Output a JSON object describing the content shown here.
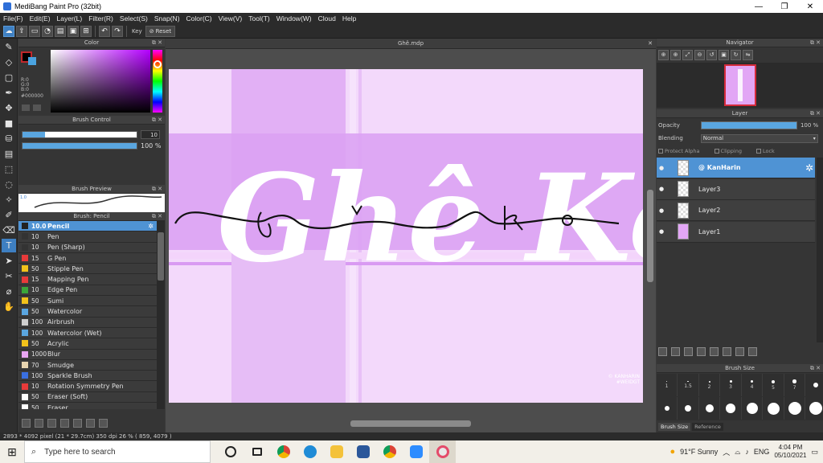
{
  "window": {
    "title": "MediBang Paint Pro (32bit)",
    "minimize": "—",
    "maximize": "❐",
    "close": "✕"
  },
  "menu": [
    "File(F)",
    "Edit(E)",
    "Layer(L)",
    "Filter(R)",
    "Select(S)",
    "Snap(N)",
    "Color(C)",
    "View(V)",
    "Tool(T)",
    "Window(W)",
    "Cloud",
    "Help"
  ],
  "toolbar": {
    "key_label": "Key",
    "reset_label": "Reset"
  },
  "color_panel": {
    "title": "Color",
    "fg_color": "#000000",
    "bg_color": "#4aa3e0",
    "rgb_readout": "R:0\nG:0\nB:0",
    "hex": "#000000"
  },
  "brush_control": {
    "title": "Brush Control",
    "size_value": "10",
    "size_fill": 0.2,
    "opacity_value": "100 %",
    "opacity_fill": 1.0
  },
  "brush_preview": {
    "title": "Brush Preview",
    "label": "1.0"
  },
  "brush_list": {
    "title": "Brush: Pencil",
    "items": [
      {
        "size": "10.0",
        "name": "Pencil",
        "color": "#222222",
        "active": true
      },
      {
        "size": "10",
        "name": "Pen",
        "color": "#333333"
      },
      {
        "size": "10",
        "name": "Pen (Sharp)",
        "color": "#333333"
      },
      {
        "size": "15",
        "name": "G Pen",
        "color": "#e83a3a"
      },
      {
        "size": "50",
        "name": "Stipple Pen",
        "color": "#f2c21b"
      },
      {
        "size": "15",
        "name": "Mapping Pen",
        "color": "#e83a3a"
      },
      {
        "size": "10",
        "name": "Edge Pen",
        "color": "#3aa63a"
      },
      {
        "size": "50",
        "name": "Sumi",
        "color": "#f2c21b"
      },
      {
        "size": "50",
        "name": "Watercolor",
        "color": "#5aa6e0"
      },
      {
        "size": "100",
        "name": "Airbrush",
        "color": "#cfcfcf"
      },
      {
        "size": "100",
        "name": "Watercolor (Wet)",
        "color": "#5aa6e0"
      },
      {
        "size": "50",
        "name": "Acrylic",
        "color": "#f2c21b"
      },
      {
        "size": "1000",
        "name": "Blur",
        "color": "#e9a6f3"
      },
      {
        "size": "70",
        "name": "Smudge",
        "color": "#e8d5b0"
      },
      {
        "size": "100",
        "name": "Sparkle Brush",
        "color": "#3a6fe0"
      },
      {
        "size": "10",
        "name": "Rotation Symmetry Pen",
        "color": "#e83a3a"
      },
      {
        "size": "50",
        "name": "Eraser (Soft)",
        "color": "#ffffff"
      },
      {
        "size": "50",
        "name": "Eraser",
        "color": "#ffffff"
      }
    ]
  },
  "canvas": {
    "tab_title": "Ghê.mdp",
    "script_text": "Ghê Ko",
    "watermark": "© KANHARIN\n#WEIDGT"
  },
  "navigator": {
    "title": "Navigator"
  },
  "layer_panel": {
    "title": "Layer",
    "opacity_label": "Opacity",
    "opacity_value": "100 %",
    "blending_label": "Blending",
    "blending_value": "Normal",
    "protect_alpha": "Protect Alpha",
    "clipping": "Clipping",
    "lock": "Lock",
    "layers": [
      {
        "name": "@ KanHarin",
        "active": true,
        "thumb": "check"
      },
      {
        "name": "Layer3",
        "thumb": "check"
      },
      {
        "name": "Layer2",
        "thumb": "check"
      },
      {
        "name": "Layer1",
        "thumb": "pink"
      }
    ]
  },
  "brush_size": {
    "title": "Brush Size",
    "labels": [
      "1",
      "1.5",
      "2",
      "3",
      "4",
      "5",
      "7"
    ],
    "tab_size": "Brush Size",
    "tab_reference": "Reference"
  },
  "status": {
    "text": "2893 * 4092 pixel   (21 * 29.7cm)   350 dpi   26 %   ( 859, 4079 )"
  },
  "taskbar": {
    "search_placeholder": "Type here to search",
    "weather": "91°F  Sunny",
    "lang": "ENG",
    "time": "4:04 PM",
    "date": "05/10/2021"
  },
  "colors": {
    "accent": "#4f93d4",
    "canvas_bg": "#f3d9fb",
    "band": "#e2a6f5"
  }
}
